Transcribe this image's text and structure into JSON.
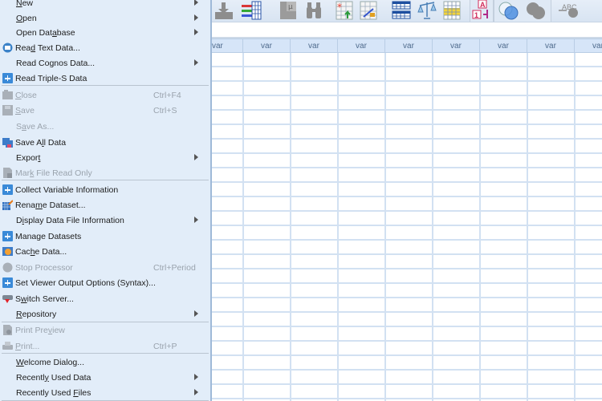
{
  "menu": {
    "items": [
      {
        "label": "New",
        "underline": 0,
        "submenu": true,
        "disabled": false,
        "icon": null
      },
      {
        "label": "Open",
        "underline": 0,
        "submenu": true,
        "disabled": false,
        "icon": null
      },
      {
        "label": "Open Database",
        "underline": 8,
        "submenu": true,
        "disabled": false,
        "icon": null
      },
      {
        "label": "Read Text Data...",
        "underline": 3,
        "submenu": false,
        "disabled": false,
        "icon": "read-text-data-icon"
      },
      {
        "label": "Read Cognos Data...",
        "underline": 7,
        "submenu": true,
        "disabled": false,
        "icon": null
      },
      {
        "label": "Read Triple-S Data",
        "underline": -1,
        "submenu": false,
        "disabled": false,
        "icon": "plus-icon"
      },
      {
        "label": "Close",
        "underline": 0,
        "shortcut": "Ctrl+F4",
        "submenu": false,
        "disabled": true,
        "icon": "close-file-icon"
      },
      {
        "label": "Save",
        "underline": 0,
        "shortcut": "Ctrl+S",
        "submenu": false,
        "disabled": true,
        "icon": "save-icon"
      },
      {
        "label": "Save As...",
        "underline": 1,
        "submenu": false,
        "disabled": true,
        "icon": null
      },
      {
        "label": "Save All Data",
        "underline": 6,
        "submenu": false,
        "disabled": false,
        "icon": "save-all-icon"
      },
      {
        "label": "Export",
        "underline": 5,
        "submenu": true,
        "disabled": false,
        "icon": null
      },
      {
        "label": "Mark File Read Only",
        "underline": 3,
        "submenu": false,
        "disabled": true,
        "icon": "mark-read-only-icon"
      },
      {
        "label": "Collect Variable Information",
        "underline": -1,
        "submenu": false,
        "disabled": false,
        "icon": "plus-icon"
      },
      {
        "label": "Rename Dataset...",
        "underline": 4,
        "submenu": false,
        "disabled": false,
        "icon": "rename-dataset-icon"
      },
      {
        "label": "Display Data File Information",
        "underline": 1,
        "submenu": true,
        "disabled": false,
        "icon": null
      },
      {
        "label": "Manage Datasets",
        "underline": -1,
        "submenu": false,
        "disabled": false,
        "icon": "plus-icon"
      },
      {
        "label": "Cache Data...",
        "underline": 3,
        "submenu": false,
        "disabled": false,
        "icon": "cache-data-icon"
      },
      {
        "label": "Stop Processor",
        "underline": -1,
        "shortcut": "Ctrl+Period",
        "submenu": false,
        "disabled": true,
        "icon": "stop-processor-icon"
      },
      {
        "label": "Set Viewer Output Options (Syntax)...",
        "underline": -1,
        "submenu": false,
        "disabled": false,
        "icon": "plus-icon"
      },
      {
        "label": "Switch Server...",
        "underline": 1,
        "submenu": false,
        "disabled": false,
        "icon": "switch-server-icon"
      },
      {
        "label": "Repository",
        "underline": 0,
        "submenu": true,
        "disabled": false,
        "icon": null
      },
      {
        "label": "Print Preview",
        "underline": 9,
        "submenu": false,
        "disabled": true,
        "icon": "print-preview-icon"
      },
      {
        "label": "Print...",
        "underline": 0,
        "shortcut": "Ctrl+P",
        "submenu": false,
        "disabled": true,
        "icon": "print-icon"
      },
      {
        "label": "Welcome Dialog...",
        "underline": 0,
        "submenu": false,
        "disabled": false,
        "icon": null
      },
      {
        "label": "Recently Used Data",
        "underline": 7,
        "submenu": true,
        "disabled": false,
        "icon": null
      },
      {
        "label": "Recently Used Files",
        "underline": 14,
        "submenu": true,
        "disabled": false,
        "icon": null
      }
    ]
  },
  "toolbar": {
    "icons": [
      "import-data-icon",
      "variables-list-icon",
      "descriptives-icon",
      "find-icon",
      "insert-cases-icon",
      "chart-builder-icon",
      "split-file-icon",
      "weight-cases-icon",
      "select-cases-icon",
      "value-labels-icon",
      "use-variable-sets-icon",
      "show-all-variables-icon",
      "spell-check-icon"
    ]
  },
  "grid": {
    "columns": [
      "var",
      "var",
      "var",
      "var",
      "var",
      "var",
      "var",
      "var",
      "var"
    ]
  },
  "colors": {
    "menu_bg": "#e2edf9",
    "header_bg": "#d6e5f8",
    "grid_line": "#d2e1f2",
    "accent_blue": "#3a8ad8"
  }
}
